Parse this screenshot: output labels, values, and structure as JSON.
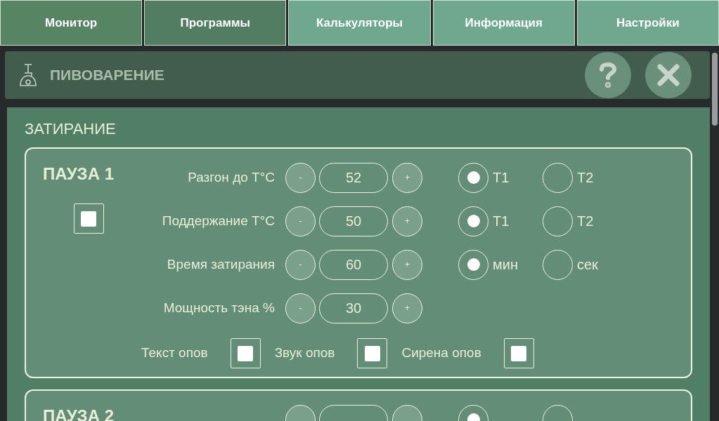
{
  "tabs": [
    {
      "label": "Монитор",
      "color": "#578564"
    },
    {
      "label": "Программы",
      "color": "#527d63"
    },
    {
      "label": "Калькуляторы",
      "color": "#6fa88e"
    },
    {
      "label": "Информация",
      "color": "#6fa88e"
    },
    {
      "label": "Настройки",
      "color": "#6fa88e"
    }
  ],
  "header": {
    "title": "ПИВОВАРЕНИЕ"
  },
  "section": {
    "title": "ЗАТИРАНИЕ"
  },
  "pauses": [
    {
      "title": "ПАУЗА 1",
      "checked": true,
      "rows": [
        {
          "label": "Разгон до Т°С",
          "value": "52",
          "minus": "-",
          "plus": "+",
          "options": [
            {
              "label": "Т1",
              "selected": true
            },
            {
              "label": "Т2",
              "selected": false
            }
          ]
        },
        {
          "label": "Поддержание Т°С",
          "value": "50",
          "minus": "-",
          "plus": "+",
          "options": [
            {
              "label": "Т1",
              "selected": true
            },
            {
              "label": "Т2",
              "selected": false
            }
          ]
        },
        {
          "label": "Время затирания",
          "value": "60",
          "minus": "-",
          "plus": "+",
          "options": [
            {
              "label": "мин",
              "selected": true
            },
            {
              "label": "сек",
              "selected": false
            }
          ]
        },
        {
          "label": "Мощность тэна %",
          "value": "30",
          "minus": "-",
          "plus": "+"
        }
      ],
      "alerts": [
        {
          "label": "Текст опов",
          "checked": true
        },
        {
          "label": "Звук опов",
          "checked": true
        },
        {
          "label": "Сирена опов",
          "checked": true
        }
      ]
    },
    {
      "title": "ПАУЗА 2",
      "rows": [
        {
          "options": [
            {
              "selected": true
            },
            {
              "selected": false
            }
          ]
        }
      ]
    }
  ]
}
